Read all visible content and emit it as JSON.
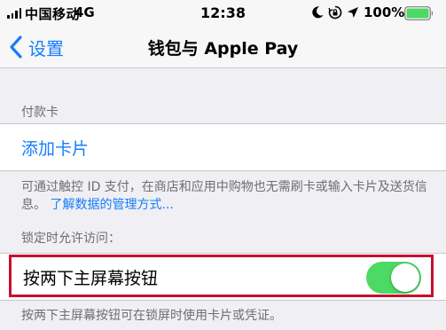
{
  "status_bar": {
    "carrier": "中国移动",
    "network": "4G",
    "time": "12:38",
    "battery_percent": "100%",
    "icons": [
      "signal-icon",
      "moon-icon",
      "lock-rotation-icon",
      "location-icon",
      "battery-icon"
    ]
  },
  "nav": {
    "back_label": "设置",
    "title": "钱包与 Apple Pay"
  },
  "payment_cards": {
    "header": "付款卡",
    "add_card_label": "添加卡片",
    "footer": "可通过触控 ID 支付，在商店和应用中购物也无需刷卡或输入卡片及送货信息。",
    "learn_more_link": "了解数据的管理方式..."
  },
  "lock_screen_access": {
    "header": "锁定时允许访问：",
    "double_click_label": "按两下主屏幕按钮",
    "double_click_enabled": true,
    "footer": "按两下主屏幕按钮可在锁屏时使用卡片或凭证。"
  },
  "colors": {
    "accent": "#157efb",
    "toggle_on": "#4cd964",
    "highlight": "#c8102e",
    "background": "#efeff4"
  }
}
